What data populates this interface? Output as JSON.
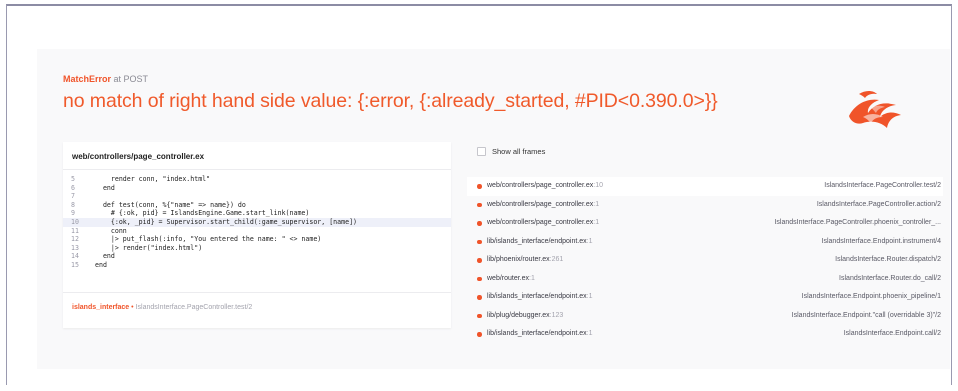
{
  "error": {
    "type": "MatchError",
    "at_text": "at POST",
    "message": "no match of right hand side value: {:error, {:already_started, #PID<0.390.0>}}"
  },
  "colors": {
    "accent": "#f0542a",
    "panel": "#f9f9fa",
    "highlight": "#eef0f9"
  },
  "logo": {
    "icon": "phoenix-logo-icon"
  },
  "code_panel": {
    "file": "web/controllers/page_controller.ex",
    "lines": [
      {
        "num": "5",
        "code": "    render conn, \"index.html\""
      },
      {
        "num": "6",
        "code": "  end"
      },
      {
        "num": "7",
        "code": ""
      },
      {
        "num": "8",
        "code": "  def test(conn, %{\"name\" => name}) do"
      },
      {
        "num": "9",
        "code": "    # {:ok, pid} = IslandsEngine.Game.start_link(name)"
      },
      {
        "num": "10",
        "code": "    {:ok, _pid} = Supervisor.start_child(:game_supervisor, [name])"
      },
      {
        "num": "11",
        "code": "    conn"
      },
      {
        "num": "12",
        "code": "    |> put_flash(:info, \"You entered the name: \" <> name)"
      },
      {
        "num": "13",
        "code": "    |> render(\"index.html\")"
      },
      {
        "num": "14",
        "code": "  end"
      },
      {
        "num": "15",
        "code": "end"
      }
    ],
    "app": "islands_interface",
    "app_sep": "•",
    "function": "IslandsInterface.PageController.test/2"
  },
  "show_all_frames": {
    "label": "Show all frames",
    "checked": false
  },
  "frames": [
    {
      "path": "web/controllers/page_controller.ex",
      "line": "10",
      "module": "IslandsInterface.PageController.test/2"
    },
    {
      "path": "web/controllers/page_controller.ex",
      "line": "1",
      "module": "IslandsInterface.PageController.action/2"
    },
    {
      "path": "web/controllers/page_controller.ex",
      "line": "1",
      "module": "IslandsInterface.PageController.phoenix_controller_..."
    },
    {
      "path": "lib/islands_interface/endpoint.ex",
      "line": "1",
      "module": "IslandsInterface.Endpoint.instrument/4"
    },
    {
      "path": "lib/phoenix/router.ex",
      "line": "261",
      "module": "IslandsInterface.Router.dispatch/2"
    },
    {
      "path": "web/router.ex",
      "line": "1",
      "module": "IslandsInterface.Router.do_call/2"
    },
    {
      "path": "lib/islands_interface/endpoint.ex",
      "line": "1",
      "module": "IslandsInterface.Endpoint.phoenix_pipeline/1"
    },
    {
      "path": "lib/plug/debugger.ex",
      "line": "123",
      "module": "IslandsInterface.Endpoint.\"call (overridable 3)\"/2"
    },
    {
      "path": "lib/islands_interface/endpoint.ex",
      "line": "1",
      "module": "IslandsInterface.Endpoint.call/2"
    }
  ]
}
